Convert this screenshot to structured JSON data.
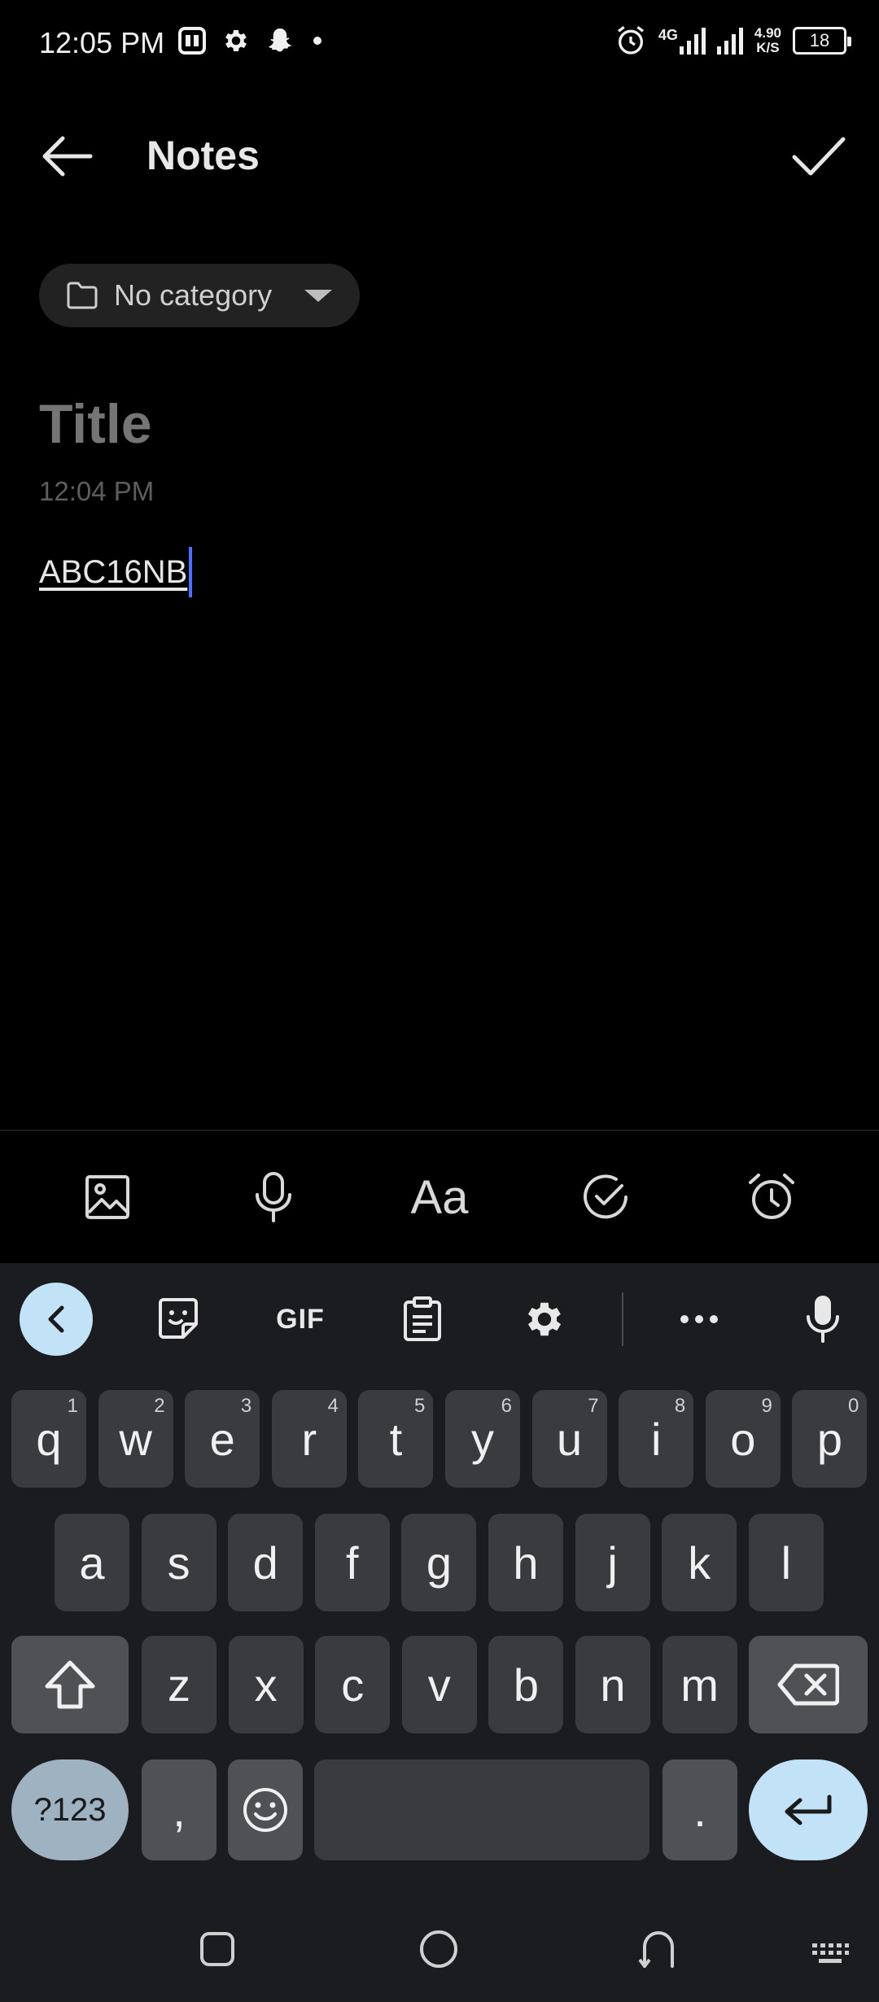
{
  "status_bar": {
    "time": "12:05 PM",
    "network_type": "4G",
    "net_speed_value": "4.90",
    "net_speed_unit": "K/S",
    "battery": "18"
  },
  "header": {
    "title": "Notes"
  },
  "note": {
    "category": "No category",
    "title_placeholder": "Title",
    "timestamp": "12:04 PM",
    "body": "ABC16NB"
  },
  "format_toolbar": {
    "text_style_label": "Aa"
  },
  "keyboard": {
    "toolbar": {
      "gif_label": "GIF"
    },
    "row1": [
      {
        "key": "q",
        "hint": "1"
      },
      {
        "key": "w",
        "hint": "2"
      },
      {
        "key": "e",
        "hint": "3"
      },
      {
        "key": "r",
        "hint": "4"
      },
      {
        "key": "t",
        "hint": "5"
      },
      {
        "key": "y",
        "hint": "6"
      },
      {
        "key": "u",
        "hint": "7"
      },
      {
        "key": "i",
        "hint": "8"
      },
      {
        "key": "o",
        "hint": "9"
      },
      {
        "key": "p",
        "hint": "0"
      }
    ],
    "row2": [
      "a",
      "s",
      "d",
      "f",
      "g",
      "h",
      "j",
      "k",
      "l"
    ],
    "row3": [
      "z",
      "x",
      "c",
      "v",
      "b",
      "n",
      "m"
    ],
    "symbols_label": "?123",
    "comma": ",",
    "period": "."
  },
  "colors": {
    "background": "#000000",
    "keyboard_bg": "#1b1c1f",
    "key": "#3a3b3f",
    "accent_light_blue": "#c2e2f7",
    "caret": "#4d6fff"
  }
}
